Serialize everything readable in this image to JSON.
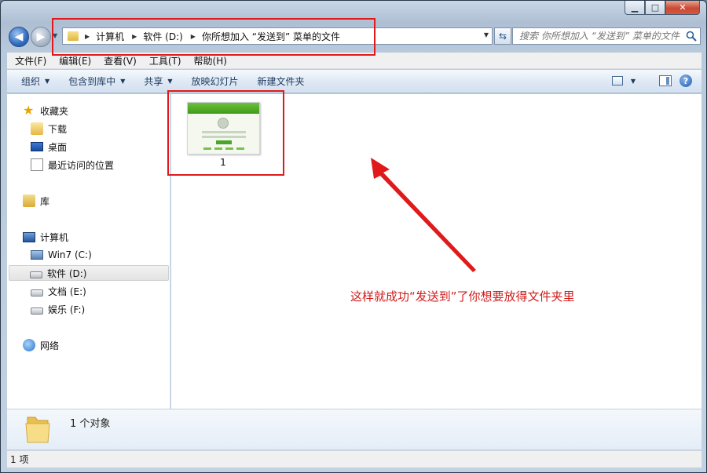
{
  "window": {
    "controls": {
      "minimize": "▁",
      "maximize": "□",
      "close": "✕"
    }
  },
  "navigation": {
    "address_crumbs": [
      "计算机",
      "软件 (D:)",
      "你所想加入 “发送到” 菜单的文件"
    ],
    "search_placeholder": "搜索 你所想加入 “发送到” 菜单的文件"
  },
  "menubar": {
    "items": [
      "文件(F)",
      "编辑(E)",
      "查看(V)",
      "工具(T)",
      "帮助(H)"
    ]
  },
  "commandbar": {
    "organize": "组织",
    "include_in_library": "包含到库中",
    "share": "共享",
    "slideshow": "放映幻灯片",
    "new_folder": "新建文件夹"
  },
  "navpane": {
    "favorites": "收藏夹",
    "downloads": "下载",
    "desktop": "桌面",
    "recent": "最近访问的位置",
    "libraries": "库",
    "computer": "计算机",
    "drive_c": "Win7 (C:)",
    "drive_d": "软件 (D:)",
    "drive_e": "文档 (E:)",
    "drive_f": "娱乐 (F:)",
    "network": "网络"
  },
  "content": {
    "files": [
      {
        "name": "1"
      }
    ],
    "annotation_note": "这样就成功“发送到”了你想要放得文件夹里"
  },
  "details": {
    "summary": "1 个对象"
  },
  "status": {
    "count": "1 项"
  },
  "colors": {
    "annotation_red": "#e01a1a",
    "note_red": "#d11a1a"
  }
}
